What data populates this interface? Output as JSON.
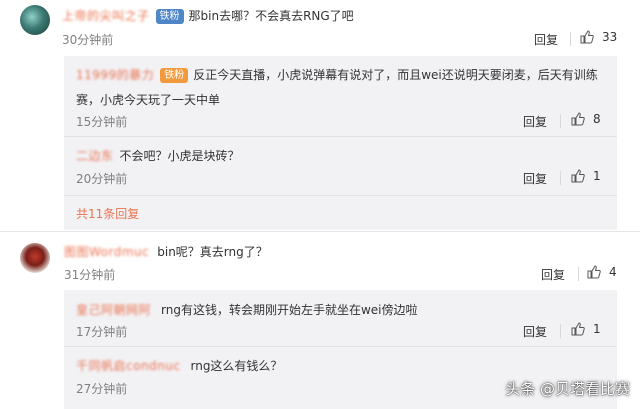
{
  "comments": [
    {
      "username": "上帝的尖叫之子",
      "badge": "铁粉",
      "text": "那bin去哪？不会真去RNG了吧",
      "time": "30分钟前",
      "reply_label": "回复",
      "likes": "33",
      "replies": [
        {
          "username": "11999的暴力",
          "badge": "铁粉",
          "text_line1": "反正今天直播，小虎说弹幕有说对了，而且wei还说明天要闭麦，后天有训练",
          "text_line2": "赛，小虎今天玩了一天中单",
          "time": "15分钟前",
          "reply_label": "回复",
          "likes": "8"
        },
        {
          "username": "二边东",
          "text": "不会吧？小虎是块砖？",
          "time": "20分钟前",
          "reply_label": "回复",
          "likes": "1"
        }
      ],
      "more_replies": "共11条回复"
    },
    {
      "username": "图图Wordmuc",
      "text": "bin呢？真去rng了？",
      "time": "31分钟前",
      "reply_label": "回复",
      "likes": "4",
      "replies": [
        {
          "username": "皇己阿朝网阿",
          "text": "rng有这钱，转会期刚开始左手就坐在wei傍边啦",
          "time": "17分钟前",
          "reply_label": "回复",
          "likes": "1"
        },
        {
          "username": "千同帆启condnuc",
          "text": "rng这么有钱么？",
          "time": "27分钟前"
        }
      ]
    }
  ],
  "watermark": "头条 @贝塔看比赛",
  "colors": {
    "username": "#eb7350",
    "badge_blue": "#4e86c8",
    "badge_orange": "#f29a3b",
    "reply_bg": "#f2f2f5"
  }
}
